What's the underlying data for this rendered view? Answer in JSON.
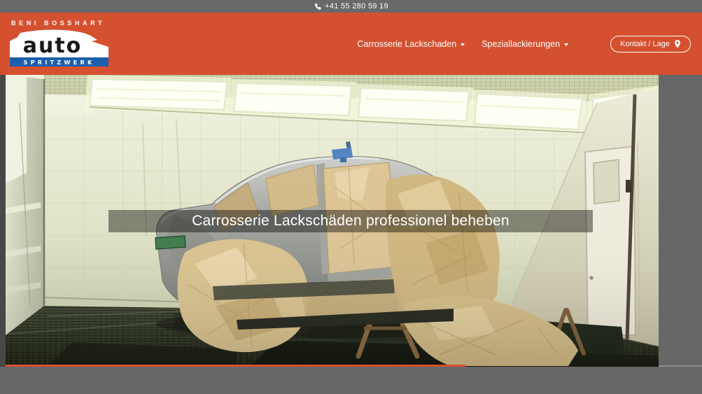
{
  "topbar": {
    "phone": "+41 55 280 59 19"
  },
  "header": {
    "logo": {
      "owner": "BENI BOSSHART",
      "brand": "auto",
      "sub": "SPRITZWERK"
    },
    "nav_items": [
      {
        "label": "Carrosserie Lackschaden"
      },
      {
        "label": "Speziallackierungen"
      }
    ],
    "cta_label": "Kontakt / Lage"
  },
  "hero": {
    "caption": "Carrosserie Lackschäden professionel beheben"
  },
  "icons": {
    "phone": "phone-icon",
    "map_pin": "map-pin-icon",
    "dropdown": "chevron-down-icon"
  },
  "colors": {
    "topbar_bg": "#696969",
    "header_bg": "#d5502f",
    "logo_blue": "#1c5fad",
    "progress_orange": "#d6502f",
    "page_bg": "#676767"
  }
}
